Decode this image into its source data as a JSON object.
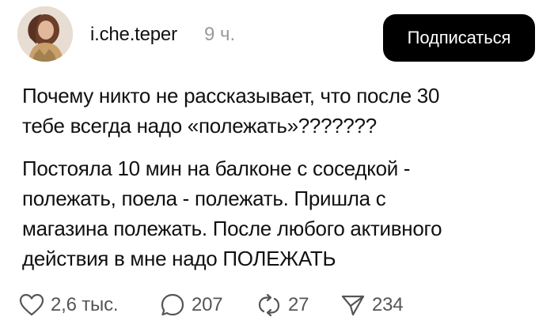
{
  "post": {
    "username": "i.che.teper",
    "timestamp": "9 ч.",
    "subscribe_label": "Подписаться",
    "paragraph1": [
      "Почему никто не рассказывает, что после 30",
      "тебе всегда надо «полежать»???????"
    ],
    "paragraph2": [
      "Постояла 10 мин на балконе с соседкой -",
      "полежать, поела - полежать. Пришла с",
      "магазина полежать. После любого активного",
      "действия в мне надо ПОЛЕЖАТЬ"
    ]
  },
  "actions": {
    "likes": "2,6 тыс.",
    "comments": "207",
    "reposts": "27",
    "shares": "234"
  },
  "icons": {
    "like": "heart-icon",
    "comment": "speech-bubble-icon",
    "repost": "repost-arrows-icon",
    "share": "paper-plane-icon"
  },
  "colors": {
    "button_bg": "#000000",
    "button_text": "#ffffff",
    "muted_text": "#9a9a9a",
    "count_text": "#555555"
  }
}
